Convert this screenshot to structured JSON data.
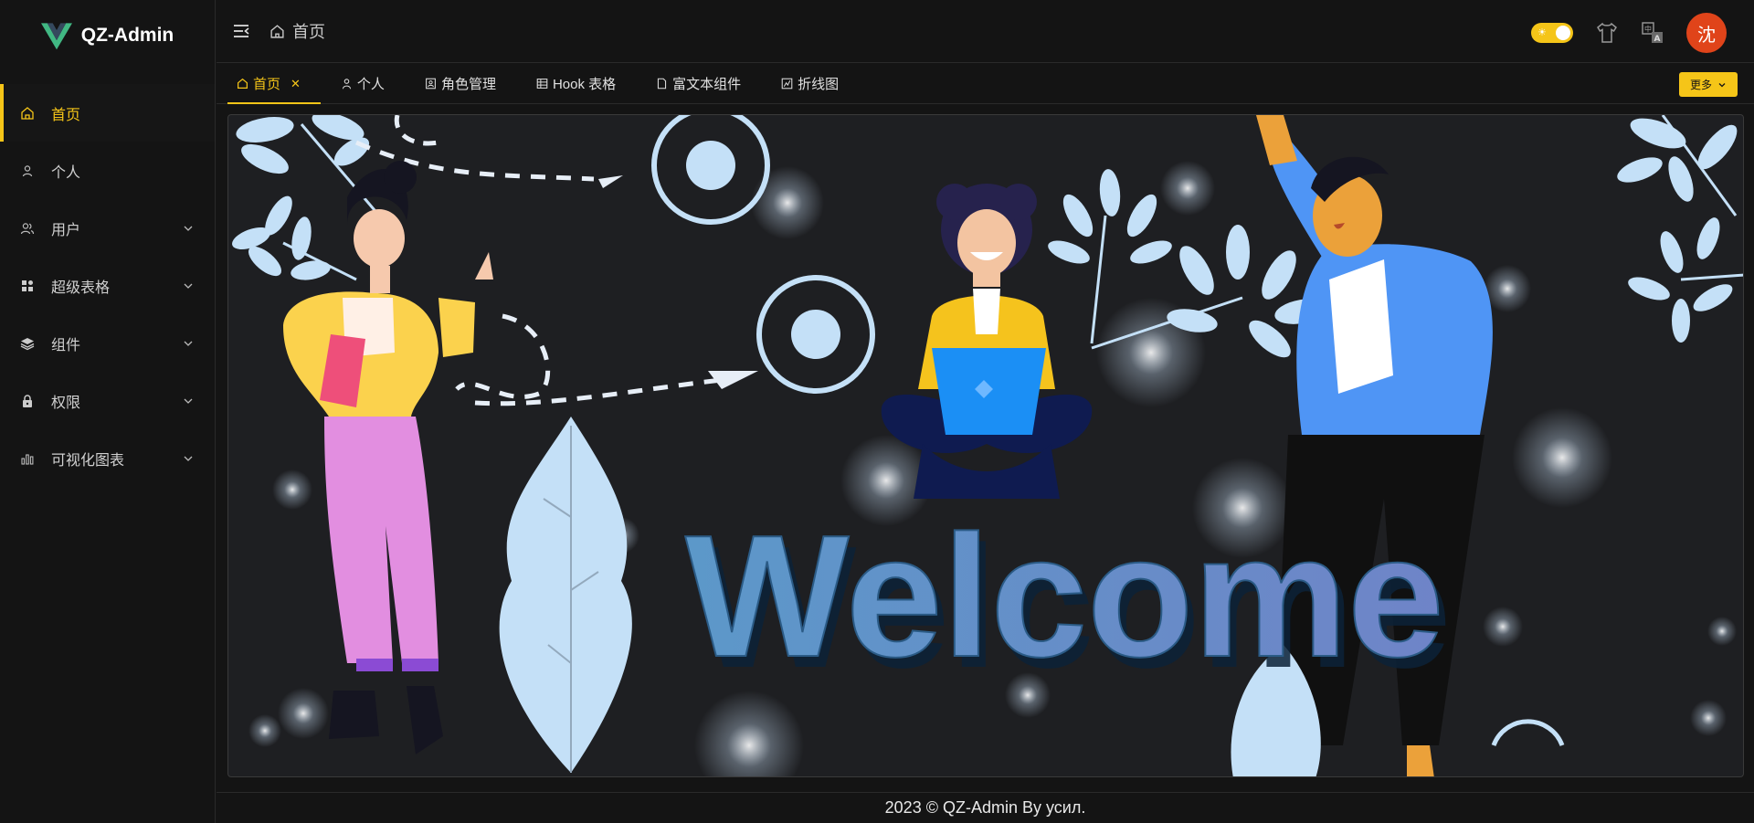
{
  "app": {
    "name": "QZ-Admin"
  },
  "sidebar": {
    "items": [
      {
        "label": "首页",
        "icon": "home-icon",
        "active": true,
        "expandable": false
      },
      {
        "label": "个人",
        "icon": "user-icon",
        "active": false,
        "expandable": false
      },
      {
        "label": "用户",
        "icon": "users-icon",
        "active": false,
        "expandable": true
      },
      {
        "label": "超级表格",
        "icon": "grid-icon",
        "active": false,
        "expandable": true
      },
      {
        "label": "组件",
        "icon": "layers-icon",
        "active": false,
        "expandable": true
      },
      {
        "label": "权限",
        "icon": "lock-icon",
        "active": false,
        "expandable": true
      },
      {
        "label": "可视化图表",
        "icon": "bar-chart-icon",
        "active": false,
        "expandable": true
      }
    ]
  },
  "header": {
    "breadcrumb": "首页"
  },
  "tabs": [
    {
      "label": "首页",
      "icon": "home-icon",
      "active": true,
      "closable": true
    },
    {
      "label": "个人",
      "icon": "user-icon",
      "active": false
    },
    {
      "label": "角色管理",
      "icon": "contact-card-icon",
      "active": false
    },
    {
      "label": "Hook 表格",
      "icon": "table-icon",
      "active": false
    },
    {
      "label": "富文本组件",
      "icon": "document-icon",
      "active": false
    },
    {
      "label": "折线图",
      "icon": "line-chart-icon",
      "active": false
    }
  ],
  "more_button": "更多",
  "avatar": {
    "initial": "沈"
  },
  "banner": {
    "text": "Welcome"
  },
  "footer": {
    "text": "2023 © QZ-Admin By усил."
  },
  "colors": {
    "accent": "#f5c518",
    "avatar": "#e0441a",
    "background": "#141414",
    "banner_bg": "#1e1f22"
  }
}
